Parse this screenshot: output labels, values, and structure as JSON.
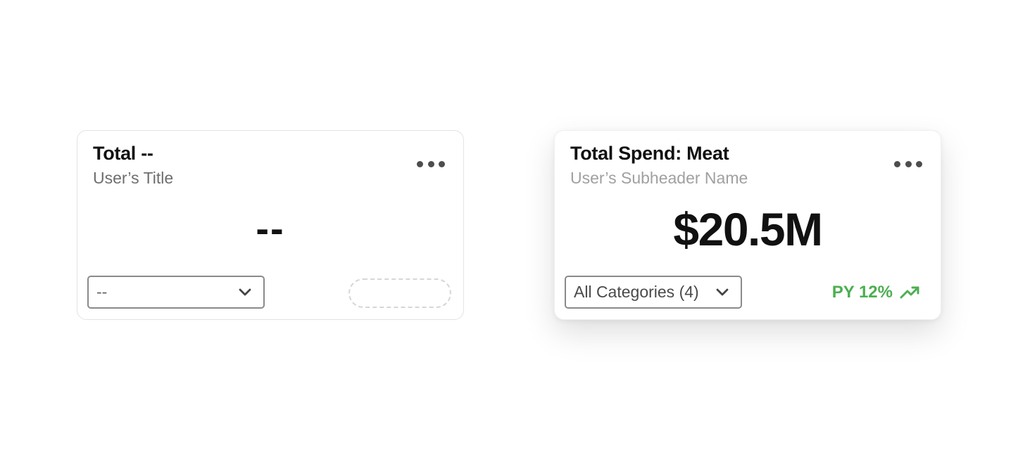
{
  "cards": [
    {
      "title": "Total --",
      "subtitle": "User’s Title",
      "value": "--",
      "filter": {
        "selected": "--"
      },
      "more_icon": "more-horizontal-icon"
    },
    {
      "title": "Total Spend: Meat",
      "subtitle": "User’s Subheader Name",
      "value": "$20.5M",
      "filter": {
        "selected": "All Categories (4)"
      },
      "trend": {
        "label": "PY 12%",
        "direction": "up",
        "icon": "trending-up-icon",
        "color": "#4caf50"
      },
      "more_icon": "more-horizontal-icon"
    }
  ]
}
